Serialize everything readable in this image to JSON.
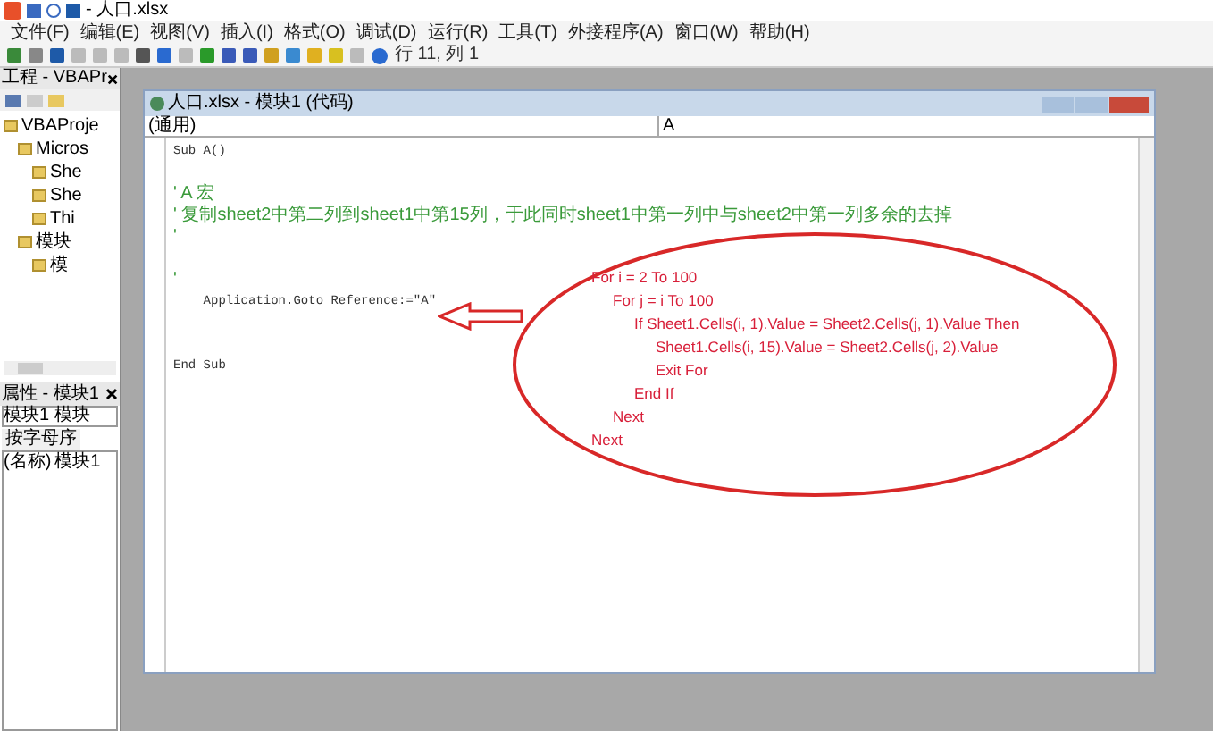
{
  "window": {
    "title": "- 人口.xlsx"
  },
  "menu": [
    "文件(F)",
    "编辑(E)",
    "视图(V)",
    "插入(I)",
    "格式(O)",
    "调试(D)",
    "运行(R)",
    "工具(T)",
    "外接程序(A)",
    "窗口(W)",
    "帮助(H)"
  ],
  "toolbar": {
    "position": "行 11, 列 1"
  },
  "project_panel": {
    "title": "工程 - VBAPr",
    "tree": [
      {
        "label": "VBAProje",
        "children": [
          {
            "label": "Micros",
            "children": [
              {
                "label": "She"
              },
              {
                "label": "She"
              },
              {
                "label": "Thi"
              }
            ]
          },
          {
            "label": "模块",
            "children": [
              {
                "label": "模"
              }
            ]
          }
        ]
      }
    ]
  },
  "properties_panel": {
    "title": "属性 - 模块1",
    "object": "模块1 模块",
    "tab": "按字母序",
    "row": {
      "name": "(名称)",
      "value": "模块1"
    }
  },
  "code_window": {
    "title": "人口.xlsx - 模块1 (代码)",
    "object": "(通用)",
    "procedure": "A",
    "lines": [
      {
        "kind": "code",
        "text": "Sub A()"
      },
      {
        "kind": "blank"
      },
      {
        "kind": "comment",
        "text": "' A 宏"
      },
      {
        "kind": "comment",
        "text": "' 复制sheet2中第二列到sheet1中第15列，于此同时sheet1中第一列中与sheet2中第一列多余的去掉"
      },
      {
        "kind": "comment",
        "text": "'"
      },
      {
        "kind": "blank"
      },
      {
        "kind": "comment",
        "text": "'"
      },
      {
        "kind": "code",
        "text": "    Application.Goto Reference:=\"A\""
      },
      {
        "kind": "blank"
      },
      {
        "kind": "blank"
      },
      {
        "kind": "code",
        "text": "End Sub"
      }
    ]
  },
  "annotation": [
    {
      "text": "For i = 2 To 100",
      "children": [
        {
          "text": "For j = i To 100",
          "children": [
            {
              "text": "If Sheet1.Cells(i, 1).Value = Sheet2.Cells(j, 1).Value Then",
              "children": [
                {
                  "text": "Sheet1.Cells(i, 15).Value = Sheet2.Cells(j, 2).Value"
                },
                {
                  "text": "Exit For"
                }
              ]
            },
            {
              "text": "End If"
            }
          ]
        },
        {
          "text": "Next"
        }
      ]
    },
    {
      "text": "Next"
    }
  ]
}
